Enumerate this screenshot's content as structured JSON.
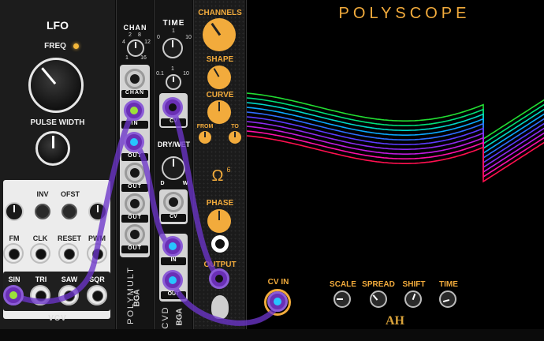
{
  "lfo": {
    "title": "LFO",
    "freq_label": "FREQ",
    "pulse_width_label": "PULSE WIDTH",
    "inv_label": "INV",
    "ofst_label": "OFST",
    "inputs": [
      "FM",
      "CLK",
      "RESET",
      "PWM"
    ],
    "outputs": [
      "SIN",
      "TRI",
      "SAW",
      "SQR"
    ],
    "brand": "VCV"
  },
  "polymult": {
    "chan_label": "CHAN",
    "chan_ticks": [
      "2",
      "4",
      "8",
      "12",
      "1",
      "16"
    ],
    "slot_top": "CHAN",
    "slot_in": "IN",
    "slot_out": "OUT",
    "name": "POLYMULT",
    "brand": "BGA"
  },
  "cvd": {
    "time_label": "TIME",
    "time_ticks": [
      "0",
      "1",
      "10",
      "0.1",
      "1",
      "10"
    ],
    "cv_label": "CV",
    "drywet_label": "DRY/WET",
    "d_label": "D",
    "w_label": "W",
    "in_label": "IN",
    "out_label": "OUT",
    "name": "CVD",
    "brand": "BGA"
  },
  "omega": {
    "channels_label": "CHANNELS",
    "shape_label": "SHAPE",
    "curve_label": "CURVE",
    "from_label": "FROM",
    "to_label": "TO",
    "symbol": "Ω",
    "sup": "6",
    "phase_label": "PHASE",
    "output_label": "OUTPUT"
  },
  "polyscope": {
    "title": "POLYSCOPE",
    "cv_in_label": "CV IN",
    "knobs": [
      "SCALE",
      "SPREAD",
      "SHIFT",
      "TIME"
    ],
    "logo": "AH",
    "trace_colors": [
      "#22dd33",
      "#00e07a",
      "#00d8c8",
      "#0aa8ff",
      "#2f6dff",
      "#5c3cff",
      "#8c2cf0",
      "#c01ce0",
      "#ff10a8",
      "#ff1050"
    ]
  },
  "colors": {
    "accent": "#f2ab3c",
    "cable": "#7d3fd0",
    "jack_glow": "#27c4ff"
  }
}
